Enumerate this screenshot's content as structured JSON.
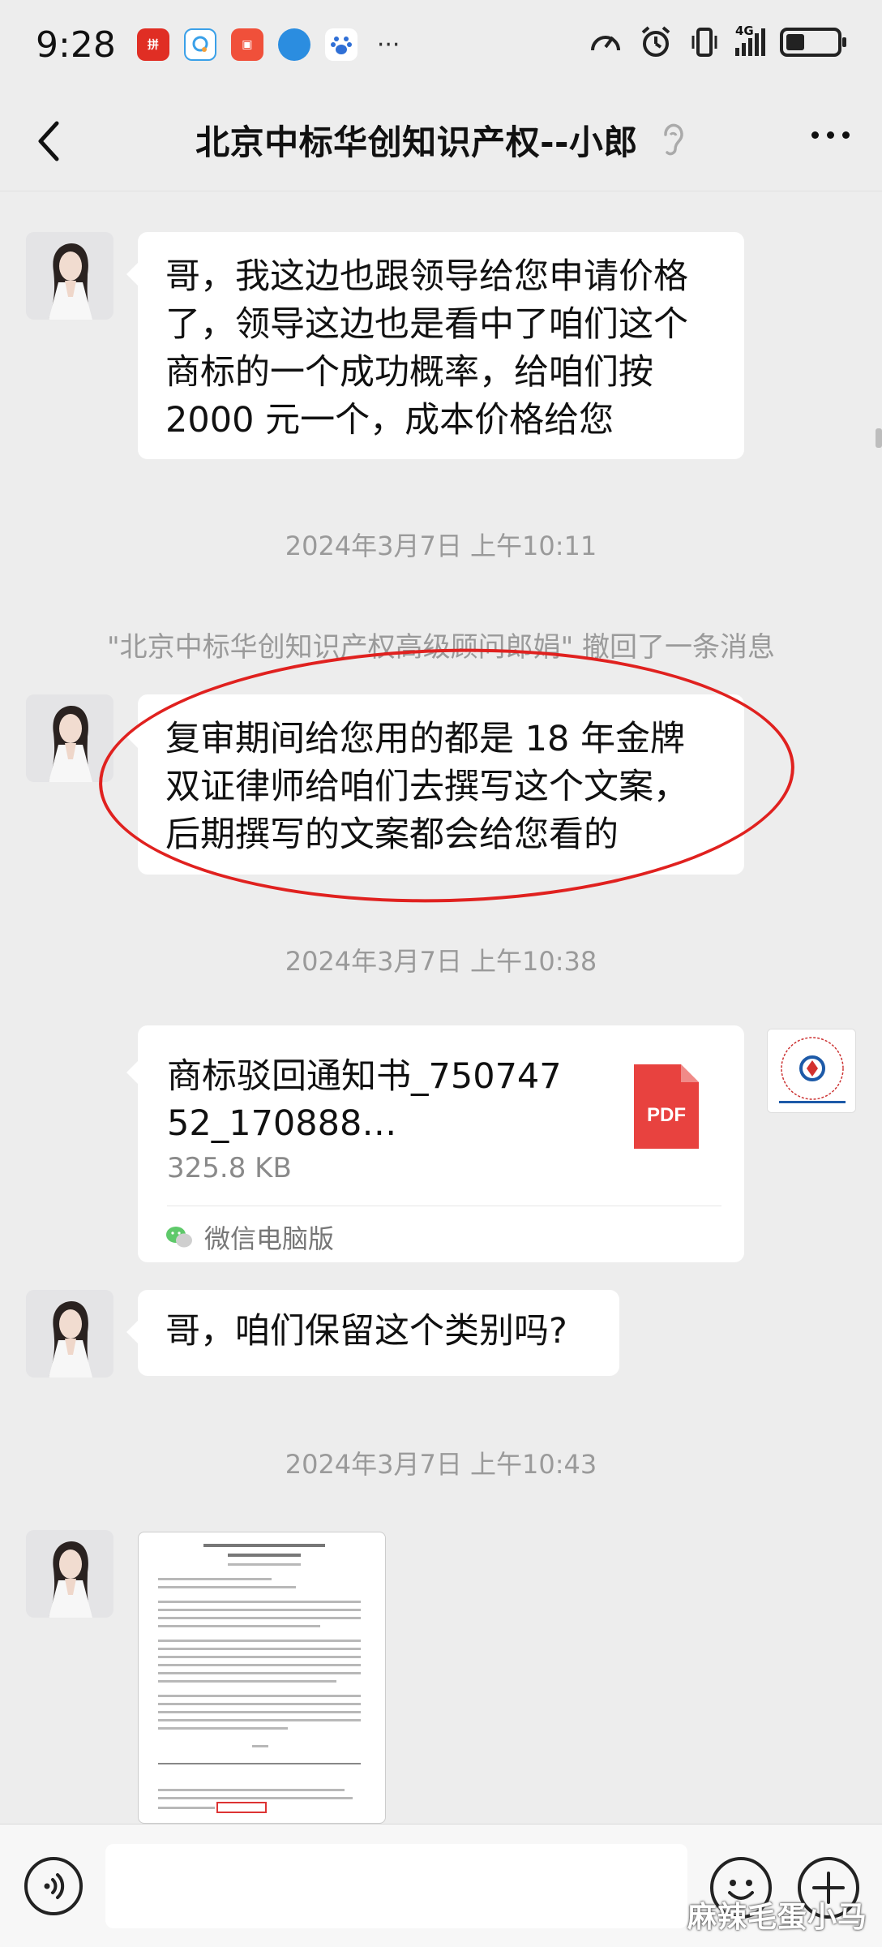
{
  "status_bar": {
    "time": "9:28",
    "network": "4G",
    "notification_icons": [
      "pinduoduo-icon",
      "qq-icon",
      "chat-icon",
      "browser-icon",
      "baidu-icon"
    ],
    "more_notifications": "···"
  },
  "header": {
    "title": "北京中标华创知识产权--小郎",
    "back_icon": "chevron-left-icon",
    "ear_icon": "ear-icon",
    "more_icon": "more-dots-icon"
  },
  "messages": [
    {
      "type": "text",
      "sender": "contact",
      "lines": [
        "哥，我这边也跟领导给您申请价格",
        "了，领导这边也是看中了咱们这个",
        "商标的一个成功概率，给咱们按",
        "2000 元一个，成本价格给您"
      ]
    },
    {
      "type": "timestamp",
      "text": "2024年3月7日 上午10:11"
    },
    {
      "type": "recall",
      "text": "\"北京中标华创知识产权高级顾问郎娟\" 撤回了一条消息"
    },
    {
      "type": "text",
      "sender": "contact",
      "lines": [
        "复审期间给您用的都是 18 年金牌",
        "双证律师给咱们去撰写这个文案，",
        "后期撰写的文案都会给您看的"
      ]
    },
    {
      "type": "timestamp",
      "text": "2024年3月7日 上午10:38"
    },
    {
      "type": "file",
      "sender": "self",
      "file_name": "商标驳回通知书_75074752_170888…",
      "file_size": "325.8 KB",
      "file_type": "PDF",
      "source": "微信电脑版"
    },
    {
      "type": "text",
      "sender": "contact",
      "lines": [
        "哥，咱们保留这个类别吗?"
      ]
    },
    {
      "type": "timestamp",
      "text": "2024年3月7日 上午10:43"
    },
    {
      "type": "image",
      "sender": "contact",
      "content": "document-image"
    }
  ],
  "input_bar": {
    "voice_icon": "voice-icon",
    "emoji_icon": "emoji-icon",
    "plus_icon": "plus-icon"
  },
  "watermark": "麻辣毛蛋小马",
  "colors": {
    "background": "#ededed",
    "bubble": "#ffffff",
    "annotation": "#e0211f",
    "pdf": "#e8423f",
    "timestamp": "#9a9a9a"
  }
}
